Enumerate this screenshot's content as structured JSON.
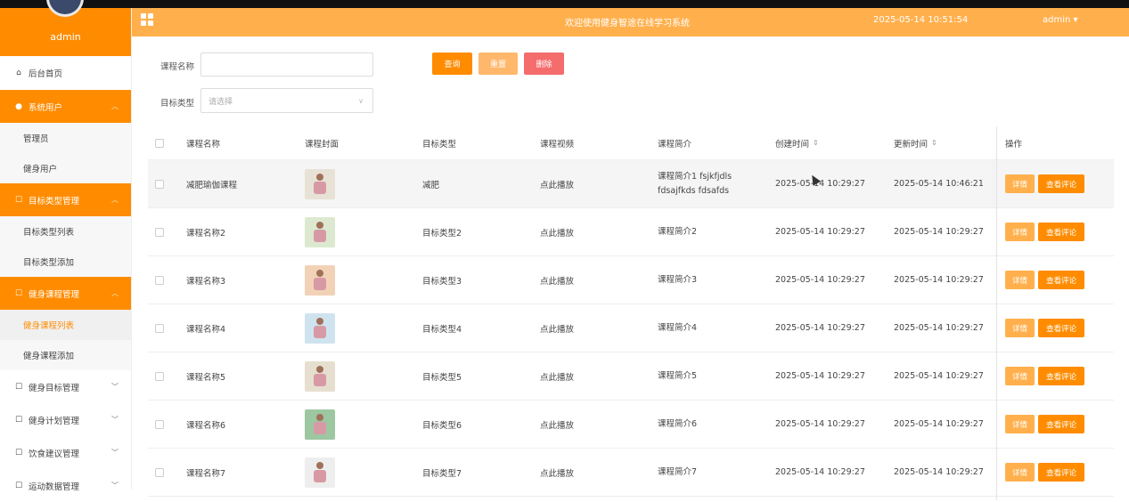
{
  "sidebar": {
    "username": "admin",
    "items": [
      {
        "label": "后台首页",
        "icon": "home-icon",
        "type": "top",
        "active": false,
        "chevron": ""
      },
      {
        "label": "系统用户",
        "icon": "user-icon",
        "type": "top",
        "active": true,
        "chevron": "^"
      },
      {
        "label": "管理员",
        "type": "sub"
      },
      {
        "label": "健身用户",
        "type": "sub"
      },
      {
        "label": "目标类型管理",
        "icon": "edit-icon",
        "type": "top",
        "active": true,
        "chevron": "^"
      },
      {
        "label": "目标类型列表",
        "type": "sub"
      },
      {
        "label": "目标类型添加",
        "type": "sub"
      },
      {
        "label": "健身课程管理",
        "icon": "edit-icon",
        "type": "top",
        "active": true,
        "chevron": "^"
      },
      {
        "label": "健身课程列表",
        "type": "sub",
        "current": true
      },
      {
        "label": "健身课程添加",
        "type": "sub"
      },
      {
        "label": "健身目标管理",
        "icon": "edit-icon",
        "type": "top",
        "active": false,
        "chevron": "v"
      },
      {
        "label": "健身计划管理",
        "icon": "edit-icon",
        "type": "top",
        "active": false,
        "chevron": "v"
      },
      {
        "label": "饮食建议管理",
        "icon": "edit-icon",
        "type": "top",
        "active": false,
        "chevron": "v"
      },
      {
        "label": "运动数据管理",
        "icon": "edit-icon",
        "type": "top",
        "active": false,
        "chevron": "v"
      }
    ]
  },
  "header": {
    "title": "欢迎使用健身智途在线学习系统",
    "datetime": "2025-05-14 10:51:54",
    "user": "admin ▾"
  },
  "search": {
    "course_name_label": "课程名称",
    "course_name_value": "",
    "target_type_label": "目标类型",
    "target_type_placeholder": "请选择",
    "query_label": "查询",
    "reset_label": "重置",
    "delete_label": "删除"
  },
  "table": {
    "columns": [
      "课程名称",
      "课程封面",
      "目标类型",
      "课程视频",
      "课程简介",
      "创建时间",
      "更新时间",
      "操作"
    ],
    "sort_glyph": "⇕",
    "detail_label": "详情",
    "comments_label": "查看评论",
    "rows": [
      {
        "name": "减肥瑜伽课程",
        "type": "减肥",
        "video": "点此播放",
        "intro": "课程简介1 fsjkfjdls fdsajfkds fdsafds",
        "created": "2025-05-14 10:29:27",
        "updated": "2025-05-14 10:46:21",
        "thumb": "#e8e2d6"
      },
      {
        "name": "课程名称2",
        "type": "目标类型2",
        "video": "点此播放",
        "intro": "课程简介2",
        "created": "2025-05-14 10:29:27",
        "updated": "2025-05-14 10:29:27",
        "thumb": "#dce9d0"
      },
      {
        "name": "课程名称3",
        "type": "目标类型3",
        "video": "点此播放",
        "intro": "课程简介3",
        "created": "2025-05-14 10:29:27",
        "updated": "2025-05-14 10:29:27",
        "thumb": "#f2d2b6"
      },
      {
        "name": "课程名称4",
        "type": "目标类型4",
        "video": "点此播放",
        "intro": "课程简介4",
        "created": "2025-05-14 10:29:27",
        "updated": "2025-05-14 10:29:27",
        "thumb": "#cfe3ef"
      },
      {
        "name": "课程名称5",
        "type": "目标类型5",
        "video": "点此播放",
        "intro": "课程简介5",
        "created": "2025-05-14 10:29:27",
        "updated": "2025-05-14 10:29:27",
        "thumb": "#e6dfcf"
      },
      {
        "name": "课程名称6",
        "type": "目标类型6",
        "video": "点此播放",
        "intro": "课程简介6",
        "created": "2025-05-14 10:29:27",
        "updated": "2025-05-14 10:29:27",
        "thumb": "#9cc7a1"
      },
      {
        "name": "课程名称7",
        "type": "目标类型7",
        "video": "点此播放",
        "intro": "课程简介7",
        "created": "2025-05-14 10:29:27",
        "updated": "2025-05-14 10:29:27",
        "thumb": "#eeeeee"
      }
    ]
  },
  "colors": {
    "primary": "#ff8c00",
    "header": "#ffb04d",
    "reset": "#ffb86b",
    "delete": "#f56c6c",
    "detail": "#ffb04d"
  }
}
